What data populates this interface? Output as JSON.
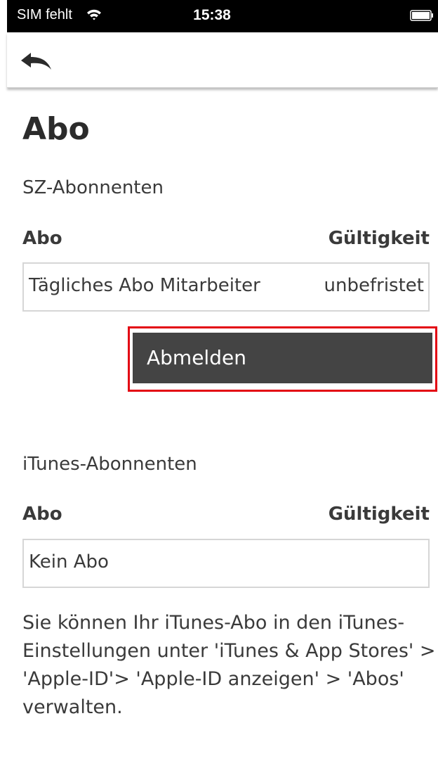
{
  "status_bar": {
    "carrier": "SIM fehlt",
    "time": "15:38",
    "wifi_icon": "wifi-icon",
    "battery_icon": "battery-icon"
  },
  "nav": {
    "back_icon": "back-arrow-icon"
  },
  "page": {
    "title": "Abo"
  },
  "sz_section": {
    "label": "SZ-Abonnenten",
    "col_abo": "Abo",
    "col_validity": "Gültigkeit",
    "subscription_name": "Tägliches Abo Mitarbeiter",
    "subscription_validity": "unbefristet",
    "unsubscribe_label": "Abmelden"
  },
  "itunes_section": {
    "label": "iTunes-Abonnenten",
    "col_abo": "Abo",
    "col_validity": "Gültigkeit",
    "subscription_name": "Kein Abo",
    "info_text": "Sie können Ihr iTunes-Abo in den iTunes-Einstellungen unter 'iTunes & App Stores' > 'Apple-ID'> 'Apple-ID anzeigen' > 'Abos' verwalten."
  },
  "colors": {
    "button_bg": "#444444",
    "highlight_border": "#e30613",
    "text": "#3a3a3a"
  }
}
